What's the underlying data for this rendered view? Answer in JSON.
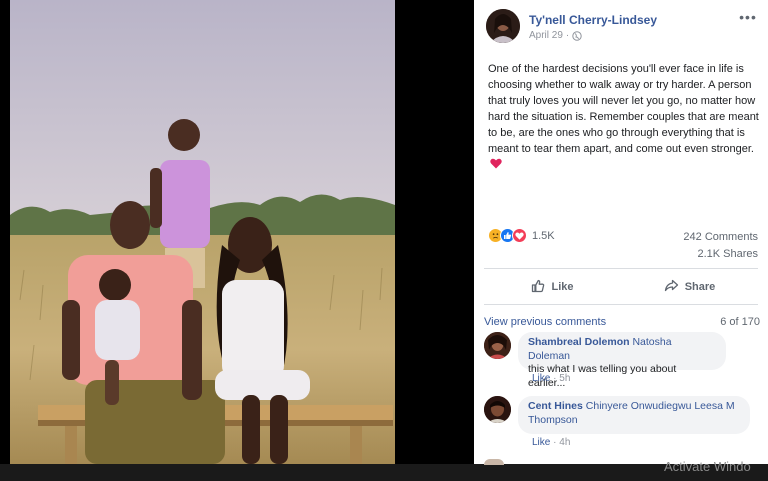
{
  "post": {
    "author": "Ty'nell Cherry-Lindsey",
    "date": "April 29",
    "date_separator": "·",
    "more_label": "•••",
    "text": "One of the hardest decisions you'll ever face in life is choosing whether to walk away or try harder. A person that truly loves you will never let you go, no matter how hard the situation is. Remember couples that are meant to be, are the ones who go through everything that is meant to tear them apart, and come out even stronger.",
    "trailing_emoji": "red-heart-icon"
  },
  "stats": {
    "reaction_count": "1.5K",
    "reaction_icons": [
      "sad-reaction-icon",
      "like-reaction-icon",
      "love-reaction-icon"
    ],
    "comments": "242 Comments",
    "shares": "2.1K Shares"
  },
  "actions": {
    "like_label": "Like",
    "share_label": "Share"
  },
  "comments_section": {
    "view_previous": "View previous comments",
    "pager": "6 of 170",
    "items": [
      {
        "name": "Shambreal Dolemon",
        "tags": "Natosha Doleman",
        "text": "this what I was telling you about earlier...",
        "like_label": "Like",
        "separator": "·",
        "time": "5h"
      },
      {
        "name": "Cent Hines",
        "tags": "Chinyere Onwudiegwu Leesa M Thompson",
        "text": "",
        "like_label": "Like",
        "separator": "·",
        "time": "4h"
      }
    ]
  },
  "overlay": {
    "watermark": "Activate Windo"
  },
  "colors": {
    "link": "#385898",
    "meta": "#90949c",
    "bubble": "#f2f3f5",
    "like_blue": "#1877f2",
    "love_red": "#f33e58",
    "sad_yellow": "#f7b125"
  }
}
